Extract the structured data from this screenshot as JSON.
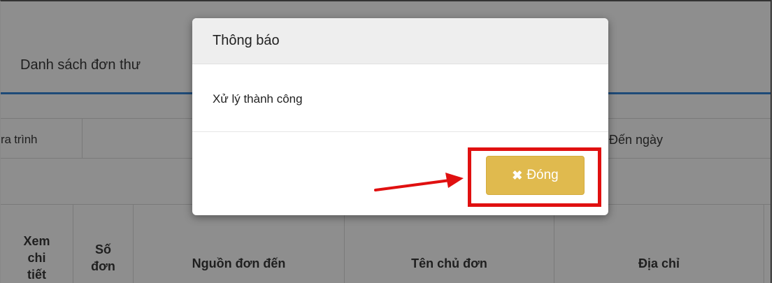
{
  "background_page": {
    "title": "Danh sách đơn thư",
    "filter_left": "ra trình",
    "filter_right": "Đến ngày",
    "table_headers": [
      [
        "Xem",
        "chi",
        "tiết"
      ],
      [
        "Số",
        "đơn"
      ],
      [
        "Nguồn đơn đến"
      ],
      [
        "Tên chủ đơn"
      ],
      [
        "Địa chỉ"
      ]
    ]
  },
  "modal": {
    "title": "Thông báo",
    "message": "Xử lý thành công",
    "close_label": "Đóng",
    "close_icon": "times-icon"
  },
  "colors": {
    "overlay": "#8e8e8e",
    "button": "#e0ba4e",
    "annotation": "#e01010",
    "accent_rule": "#1e4a78"
  }
}
